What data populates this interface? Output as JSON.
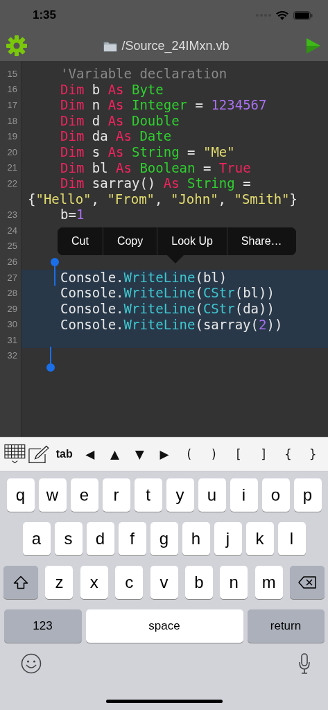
{
  "status_bar": {
    "time": "1:35"
  },
  "toolbar": {
    "title": "/Source_24IMxn.vb"
  },
  "editor": {
    "lines": [
      {
        "number": "15",
        "selected": false,
        "tokens": [
          {
            "kind": "comment",
            "text": "'Variable declaration"
          }
        ]
      },
      {
        "number": "16",
        "selected": false,
        "tokens": [
          {
            "kind": "keyword",
            "text": "Dim"
          },
          {
            "kind": "plain",
            "text": " b "
          },
          {
            "kind": "keyword",
            "text": "As"
          },
          {
            "kind": "type",
            "text": " Byte"
          }
        ]
      },
      {
        "number": "17",
        "selected": false,
        "tokens": [
          {
            "kind": "keyword",
            "text": "Dim"
          },
          {
            "kind": "plain",
            "text": " n "
          },
          {
            "kind": "keyword",
            "text": "As"
          },
          {
            "kind": "type",
            "text": " Integer"
          },
          {
            "kind": "plain",
            "text": " = "
          },
          {
            "kind": "number",
            "text": "1234567"
          }
        ]
      },
      {
        "number": "18",
        "selected": false,
        "tokens": [
          {
            "kind": "keyword",
            "text": "Dim"
          },
          {
            "kind": "plain",
            "text": " d "
          },
          {
            "kind": "keyword",
            "text": "As"
          },
          {
            "kind": "type",
            "text": " Double"
          }
        ]
      },
      {
        "number": "19",
        "selected": false,
        "tokens": [
          {
            "kind": "keyword",
            "text": "Dim"
          },
          {
            "kind": "plain",
            "text": " da "
          },
          {
            "kind": "keyword",
            "text": "As"
          },
          {
            "kind": "type",
            "text": " Date"
          }
        ]
      },
      {
        "number": "20",
        "selected": false,
        "tokens": [
          {
            "kind": "keyword",
            "text": "Dim"
          },
          {
            "kind": "plain",
            "text": " s "
          },
          {
            "kind": "keyword",
            "text": "As"
          },
          {
            "kind": "type",
            "text": " String"
          },
          {
            "kind": "plain",
            "text": " = "
          },
          {
            "kind": "string",
            "text": "\"Me\""
          }
        ]
      },
      {
        "number": "21",
        "selected": false,
        "tokens": [
          {
            "kind": "keyword",
            "text": "Dim"
          },
          {
            "kind": "plain",
            "text": " bl "
          },
          {
            "kind": "keyword",
            "text": "As"
          },
          {
            "kind": "type",
            "text": " Boolean"
          },
          {
            "kind": "plain",
            "text": " = "
          },
          {
            "kind": "keyword",
            "text": "True"
          }
        ]
      },
      {
        "number": "22",
        "selected": false,
        "tokens": [
          {
            "kind": "keyword",
            "text": "Dim"
          },
          {
            "kind": "plain",
            "text": " sarray() "
          },
          {
            "kind": "keyword",
            "text": "As"
          },
          {
            "kind": "type",
            "text": " String"
          },
          {
            "kind": "plain",
            "text": " ="
          }
        ],
        "continuation": [
          {
            "kind": "plain",
            "text": "{"
          },
          {
            "kind": "string",
            "text": "\"Hello\""
          },
          {
            "kind": "plain",
            "text": ", "
          },
          {
            "kind": "string",
            "text": "\"From\""
          },
          {
            "kind": "plain",
            "text": ", "
          },
          {
            "kind": "string",
            "text": "\"John\""
          },
          {
            "kind": "plain",
            "text": ", "
          },
          {
            "kind": "string",
            "text": "\"Smith\""
          },
          {
            "kind": "plain",
            "text": "}"
          }
        ]
      },
      {
        "number": "23",
        "selected": false,
        "tokens": [
          {
            "kind": "plain",
            "text": "b="
          },
          {
            "kind": "number",
            "text": "1"
          }
        ]
      },
      {
        "number": "24",
        "selected": false
      },
      {
        "number": "25",
        "selected": false
      },
      {
        "number": "26",
        "selected": false
      },
      {
        "number": "27",
        "selected": true,
        "tokens": [
          {
            "kind": "plain",
            "text": "Console."
          },
          {
            "kind": "method",
            "text": "WriteLine"
          },
          {
            "kind": "plain",
            "text": "(bl)"
          }
        ]
      },
      {
        "number": "28",
        "selected": true,
        "tokens": [
          {
            "kind": "plain",
            "text": "Console."
          },
          {
            "kind": "method",
            "text": "WriteLine"
          },
          {
            "kind": "plain",
            "text": "("
          },
          {
            "kind": "method",
            "text": "CStr"
          },
          {
            "kind": "plain",
            "text": "(bl))"
          }
        ]
      },
      {
        "number": "29",
        "selected": true,
        "tokens": [
          {
            "kind": "plain",
            "text": "Console."
          },
          {
            "kind": "method",
            "text": "WriteLine"
          },
          {
            "kind": "plain",
            "text": "("
          },
          {
            "kind": "method",
            "text": "CStr"
          },
          {
            "kind": "plain",
            "text": "(da))"
          }
        ]
      },
      {
        "number": "30",
        "selected": true,
        "tokens": [
          {
            "kind": "plain",
            "text": "Console."
          },
          {
            "kind": "method",
            "text": "WriteLine"
          },
          {
            "kind": "plain",
            "text": "(sarray("
          },
          {
            "kind": "number",
            "text": "2"
          },
          {
            "kind": "plain",
            "text": "))"
          }
        ]
      },
      {
        "number": "31",
        "selected": true
      },
      {
        "number": "32",
        "selected": false
      }
    ]
  },
  "context_menu": {
    "items": [
      "Cut",
      "Copy",
      "Look Up",
      "Share…"
    ]
  },
  "accessory_bar": {
    "keys": [
      "tab",
      "◀",
      "▲",
      "▼",
      "▶",
      "(",
      ")",
      "[",
      "]",
      "{",
      "}"
    ]
  },
  "keyboard": {
    "letter_rows": [
      [
        {
          "kind": "letter",
          "label": "q"
        },
        {
          "kind": "letter",
          "label": "w"
        },
        {
          "kind": "letter",
          "label": "e"
        },
        {
          "kind": "letter",
          "label": "r"
        },
        {
          "kind": "letter",
          "label": "t"
        },
        {
          "kind": "letter",
          "label": "y"
        },
        {
          "kind": "letter",
          "label": "u"
        },
        {
          "kind": "letter",
          "label": "i"
        },
        {
          "kind": "letter",
          "label": "o"
        },
        {
          "kind": "letter",
          "label": "p"
        }
      ],
      [
        {
          "kind": "letter",
          "label": "a"
        },
        {
          "kind": "letter",
          "label": "s"
        },
        {
          "kind": "letter",
          "label": "d"
        },
        {
          "kind": "letter",
          "label": "f"
        },
        {
          "kind": "letter",
          "label": "g"
        },
        {
          "kind": "letter",
          "label": "h"
        },
        {
          "kind": "letter",
          "label": "j"
        },
        {
          "kind": "letter",
          "label": "k"
        },
        {
          "kind": "letter",
          "label": "l"
        }
      ],
      [
        {
          "kind": "shift"
        },
        {
          "kind": "letter",
          "label": "z"
        },
        {
          "kind": "letter",
          "label": "x"
        },
        {
          "kind": "letter",
          "label": "c"
        },
        {
          "kind": "letter",
          "label": "v"
        },
        {
          "kind": "letter",
          "label": "b"
        },
        {
          "kind": "letter",
          "label": "n"
        },
        {
          "kind": "letter",
          "label": "m"
        },
        {
          "kind": "delete"
        }
      ]
    ],
    "numbers_key": "123",
    "space_key": "space",
    "return_key": "return"
  }
}
